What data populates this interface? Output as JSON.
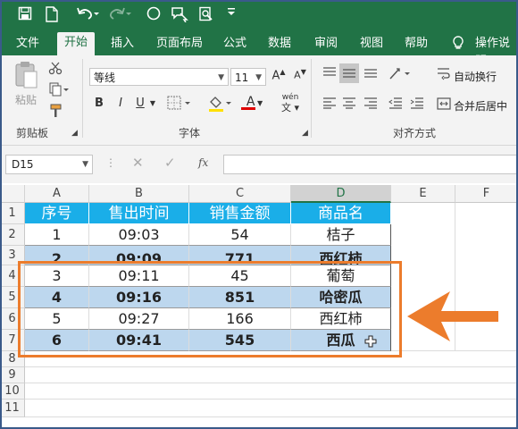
{
  "quick_access": {
    "icons": [
      "save-icon",
      "new-file-icon",
      "undo-icon",
      "redo-icon",
      "shape-icon",
      "speech-icon",
      "zoom-preview-icon",
      "customize-icon"
    ]
  },
  "tabs": [
    {
      "label": "文件",
      "active": false
    },
    {
      "label": "开始",
      "active": true
    },
    {
      "label": "插入",
      "active": false
    },
    {
      "label": "页面布局",
      "active": false
    },
    {
      "label": "公式",
      "active": false
    },
    {
      "label": "数据",
      "active": false
    },
    {
      "label": "审阅",
      "active": false
    },
    {
      "label": "视图",
      "active": false
    },
    {
      "label": "帮助",
      "active": false
    }
  ],
  "tell_me": "操作说明",
  "ribbon": {
    "clipboard": {
      "paste_label": "粘贴",
      "group_label": "剪贴板"
    },
    "font": {
      "font_name": "等线",
      "font_size": "11",
      "group_label": "字体",
      "bold": "B",
      "italic": "I",
      "underline": "U",
      "font_color_letter": "A",
      "phonetic": "wén"
    },
    "alignment": {
      "wrap_text": "自动换行",
      "merge_center": "合并后居中",
      "group_label": "对齐方式"
    }
  },
  "formula_bar": {
    "name_box": "D15",
    "fx": "fx",
    "formula": ""
  },
  "columns": [
    "A",
    "B",
    "C",
    "D",
    "E",
    "F"
  ],
  "selected_column": "D",
  "rows": [
    "1",
    "2",
    "3",
    "4",
    "5",
    "6",
    "7",
    "8",
    "9",
    "10",
    "11"
  ],
  "table": {
    "headers": [
      "序号",
      "售出时间",
      "销售金额",
      "商品名"
    ],
    "rows": [
      [
        "1",
        "09:03",
        "54",
        "桔子"
      ],
      [
        "2",
        "09:09",
        "771",
        "西红柿"
      ],
      [
        "3",
        "09:11",
        "45",
        "葡萄"
      ],
      [
        "4",
        "09:16",
        "851",
        "哈密瓜"
      ],
      [
        "5",
        "09:27",
        "166",
        "西红柿"
      ],
      [
        "6",
        "09:41",
        "545",
        "西瓜"
      ]
    ]
  },
  "colors": {
    "brand": "#217346",
    "header_fill": "#1aaee8",
    "band_fill": "#bdd7ee",
    "highlight": "#ec7c2c"
  }
}
